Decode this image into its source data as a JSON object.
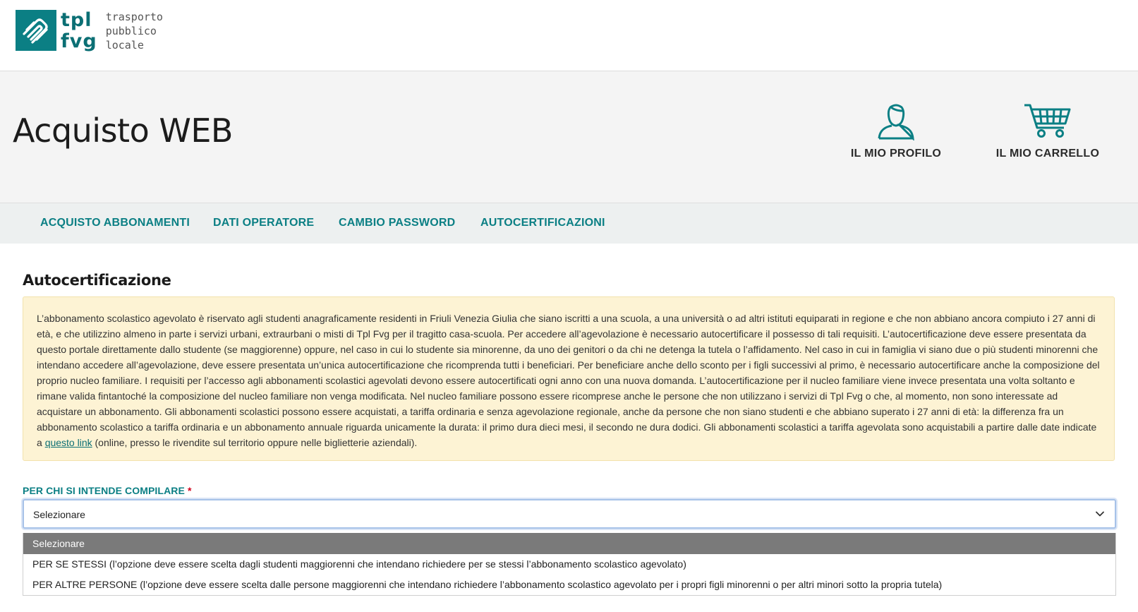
{
  "brand": {
    "logo_word_line1": "tpl",
    "logo_word_line2": "fvg",
    "tagline_line1": "trasporto",
    "tagline_line2": "pubblico",
    "tagline_line3": "locale",
    "color": "#0b7f84"
  },
  "header": {
    "title": "Acquisto WEB",
    "profile_label": "IL MIO PROFILO",
    "cart_label": "IL MIO CARRELLO",
    "profile_icon": "user-icon",
    "cart_icon": "cart-icon"
  },
  "nav": {
    "items": [
      {
        "label": "ACQUISTO ABBONAMENTI"
      },
      {
        "label": "DATI OPERATORE"
      },
      {
        "label": "CAMBIO PASSWORD"
      },
      {
        "label": "AUTOCERTIFICAZIONI"
      }
    ]
  },
  "main": {
    "section_title": "Autocertificazione",
    "notice": {
      "text_before_link": "L’abbonamento scolastico agevolato è riservato agli studenti anagraficamente residenti in Friuli Venezia Giulia che siano iscritti a una scuola, a una università o ad altri istituti equiparati in regione e che non abbiano ancora compiuto i 27 anni di età, e che utilizzino almeno in parte i servizi urbani, extraurbani o misti di Tpl Fvg per il tragitto casa-scuola. Per accedere all’agevolazione è necessario autocertificare il possesso di tali requisiti. L’autocertificazione deve essere presentata da questo portale direttamente dallo studente (se maggiorenne) oppure, nel caso in cui lo studente sia minorenne, da uno dei genitori o da chi ne detenga la tutela o l’affidamento. Nel caso in cui in famiglia vi siano due o più studenti minorenni che intendano accedere all’agevolazione, deve essere presentata un’unica autocertificazione che ricomprenda tutti i beneficiari. Per beneficiare anche dello sconto per i figli successivi al primo, è necessario autocertificare anche la composizione del proprio nucleo familiare. I requisiti per l’accesso agli abbonamenti scolastici agevolati devono essere autocertificati ogni anno con una nuova domanda. L’autocertificazione per il nucleo familiare viene invece presentata una volta soltanto e rimane valida fintantoché la composizione del nucleo familiare non venga modificata. Nel nucleo familiare possono essere ricomprese anche le persone che non utilizzano i servizi di Tpl Fvg o che, al momento, non sono interessate ad acquistare un abbonamento. Gli abbonamenti scolastici possono essere acquistati, a tariffa ordinaria e senza agevolazione regionale, anche da persone che non siano studenti e che abbiano superato i 27 anni di età: la differenza fra un abbonamento scolastico a tariffa ordinaria e un abbonamento annuale riguarda unicamente la durata: il primo dura dieci mesi, il secondo ne dura dodici. Gli abbonamenti scolastici a tariffa agevolata sono acquistabili a partire dalle date indicate a ",
      "link_text": "questo link",
      "text_after_link": " (online, presso le rivendite sul territorio oppure nelle biglietterie aziendali).",
      "background": "#fdf3d4"
    },
    "field": {
      "label": "PER CHI SI INTENDE COMPILARE",
      "required_mark": "*",
      "selected_value": "Selezionare",
      "options": [
        {
          "label": "Selezionare"
        },
        {
          "label": "PER SE STESSI (l’opzione deve essere scelta dagli studenti maggiorenni che intendano richiedere per se stessi l’abbonamento scolastico agevolato)"
        },
        {
          "label": "PER ALTRE PERSONE (l’opzione deve essere scelta dalle persone maggiorenni che intendano richiedere l’abbonamento scolastico agevolato per i propri figli minorenni o per altri minori sotto la propria tutela)"
        }
      ]
    }
  }
}
